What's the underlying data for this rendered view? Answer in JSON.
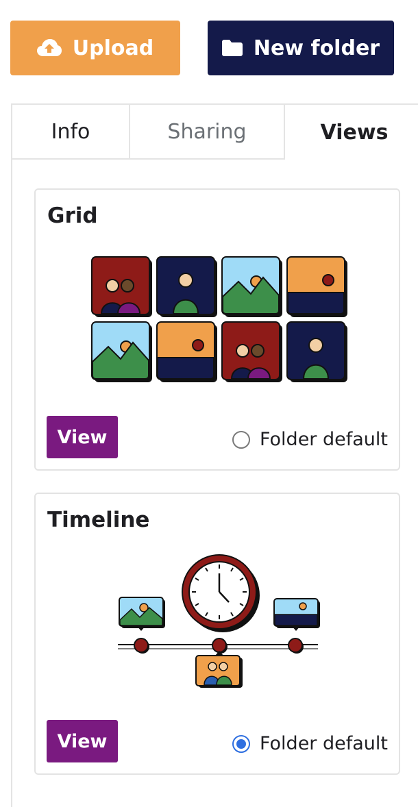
{
  "toolbar": {
    "upload_label": "Upload",
    "upload_icon": "cloud-upload-icon",
    "new_folder_label": "New folder",
    "new_folder_icon": "folder-icon",
    "upload_color": "#f0a04b",
    "new_folder_color": "#141a4a"
  },
  "tabs": [
    {
      "label": "Info",
      "active": false
    },
    {
      "label": "Sharing",
      "active": false
    },
    {
      "label": "Views",
      "active": true
    }
  ],
  "views": [
    {
      "title": "Grid",
      "button_label": "View",
      "radio_label": "Folder default",
      "checked": false
    },
    {
      "title": "Timeline",
      "button_label": "View",
      "radio_label": "Folder default",
      "checked": true
    }
  ],
  "colors": {
    "view_button": "#7a1a80",
    "radio_checked": "#2f6fe0"
  }
}
